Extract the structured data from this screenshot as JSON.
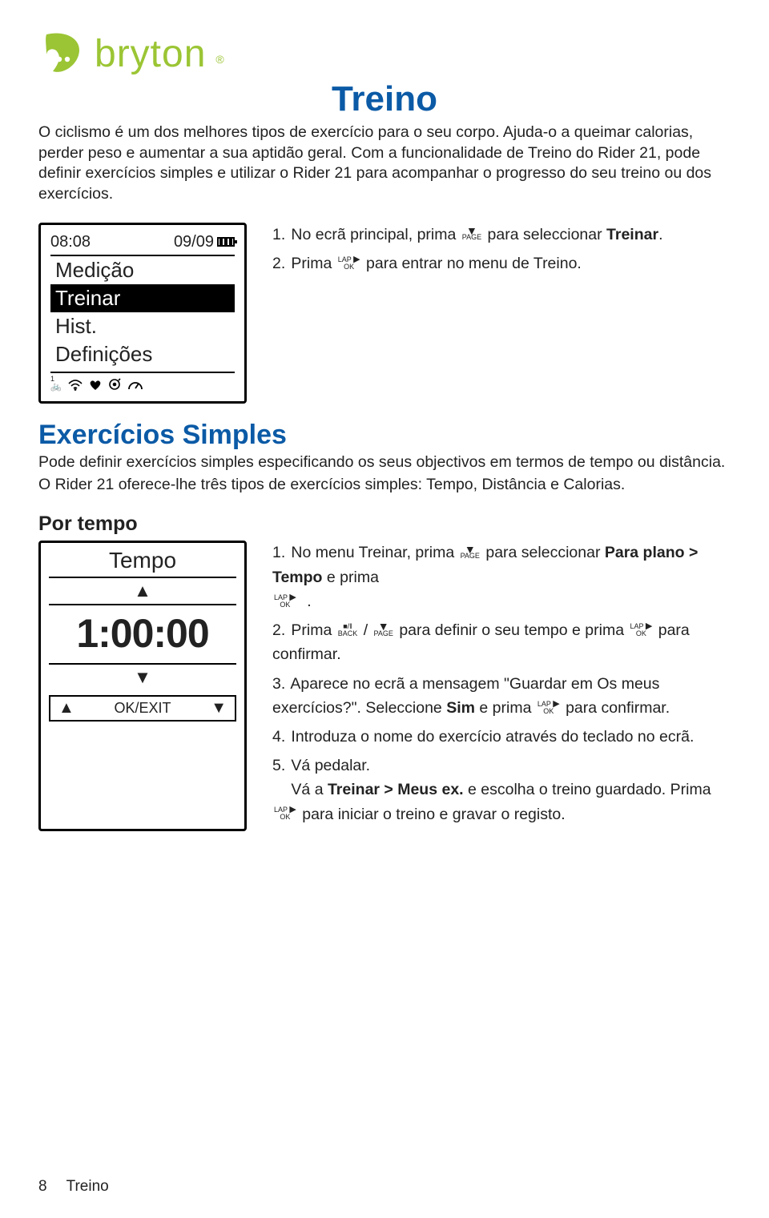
{
  "brand": "bryton",
  "page_title": "Treino",
  "intro": "O ciclismo é um dos melhores tipos de exercício para o seu corpo. Ajuda-o a queimar calorias, perder peso e aumentar a sua aptidão geral. Com a funcionalidade de Treino do Rider 21, pode definir exercícios simples e utilizar o Rider 21 para acompanhar o progresso do seu treino ou dos exercícios.",
  "device1": {
    "time": "08:08",
    "date": "09/09",
    "items": [
      "Medição",
      "Treinar",
      "Hist.",
      "Definições"
    ],
    "selected_index": 1
  },
  "steps1": [
    {
      "n": "1.",
      "pre": "No ecrã principal, prima ",
      "btn": "page",
      "mid": " para seleccionar ",
      "bold": "Treinar",
      "post": "."
    },
    {
      "n": "2.",
      "pre": "Prima ",
      "btn": "lapok",
      "mid": " para entrar no menu de Treino.",
      "bold": "",
      "post": ""
    }
  ],
  "section2_title": "Exercícios Simples",
  "section2_p1": "Pode definir exercícios simples especificando os seus objectivos em termos de tempo ou distância.",
  "section2_p2": "O Rider 21 oferece-lhe três tipos de exercícios simples:  Tempo, Distância e Calorias.",
  "sub_title": "Por tempo",
  "device2": {
    "title": "Tempo",
    "value": "1:00:00",
    "footer_mid": "OK/EXIT"
  },
  "steps2": {
    "s1_a": "No menu Treinar, prima ",
    "s1_b": " para seleccionar ",
    "s1_bold": "Para plano > Tempo",
    "s1_c": " e prima ",
    "s1_end": ".",
    "s2_a": "Prima ",
    "s2_b": " para definir o seu tempo e prima ",
    "s2_c": " para confirmar.",
    "s3_a": "Aparece no ecrã a mensagem \"Guardar em Os meus exercícios?\". Seleccione ",
    "s3_bold": "Sim",
    "s3_b": " e prima ",
    "s3_c": " para confirmar.",
    "s4": "Introduza o nome do exercício através do teclado no ecrã.",
    "s5": "Vá pedalar.",
    "s5b_a": "Vá a ",
    "s5b_bold": "Treinar > Meus ex.",
    "s5b_b": " e escolha o treino guardado. Prima ",
    "s5b_c": " para iniciar o treino e gravar o registo."
  },
  "footer": {
    "page": "8",
    "section": "Treino"
  }
}
